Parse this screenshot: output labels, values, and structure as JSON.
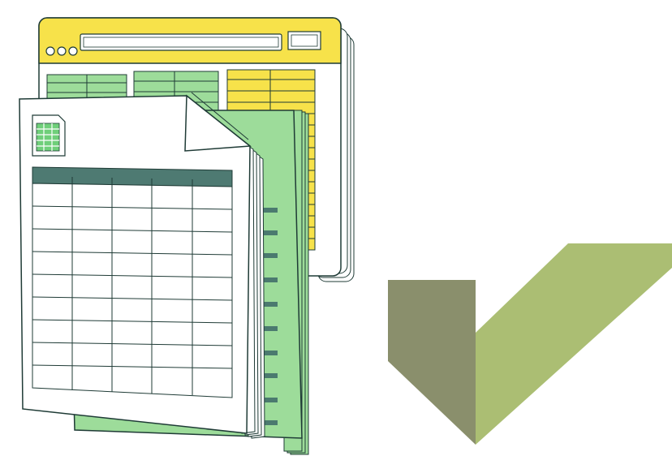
{
  "colors": {
    "outline": "#1f3b36",
    "window_bar": "#f7e24a",
    "window_bg": "#ffffff",
    "green_cells": "#9ddc9a",
    "yellow_cells": "#f7e24a",
    "binder_green": "#9ddc9a",
    "binder_tab": "#4b7a6f",
    "sheet_header": "#4e7a72",
    "sheet_icon": "#6fcf7a",
    "check_dark": "#8a8f6c",
    "check_light": "#abbe73"
  },
  "icons": {
    "window": "browser-window-icon",
    "document": "spreadsheet-document-icon",
    "file_badge": "spreadsheet-file-icon",
    "check": "checkmark-icon"
  }
}
